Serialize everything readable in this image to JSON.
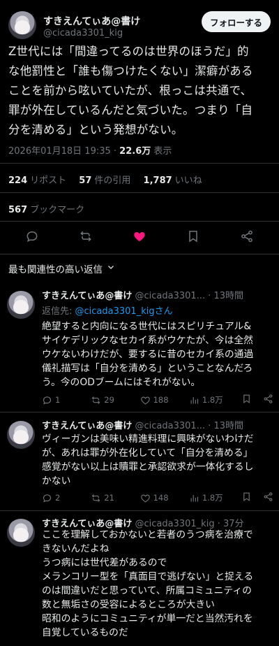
{
  "main": {
    "author_name": "すきえんてぃあ@書け",
    "handle": "@cicada3301_kig",
    "follow_label": "フォローする",
    "text": "Z世代には「間違ってるのは世界のほうだ」的\nな他罰性と「誰も傷つけたくない」潔癖がある\nことを前から呟いていたが、根っこは共通で、\n罪が外在しているんだと気づいた。つまり「自\n分を清める」という発想がない。",
    "date": "2026年01月18日 19:35 · ",
    "views": "22.6万",
    "views_label": " 表示"
  },
  "stats": {
    "reposts": "224",
    "reposts_label": "リポスト",
    "quotes": "57",
    "quotes_label": "件の引用",
    "likes": "1,787",
    "likes_label": "いいね",
    "bookmarks": "567",
    "bookmarks_label": "ブックマーク"
  },
  "sort_label": "最も関連性の高い返信",
  "replies": [
    {
      "name": "すきえんてぃあ@書け",
      "handle": "@cicada3301...",
      "time": "· 13時間",
      "reply_to_prefix": "返信先: ",
      "reply_to": "@cicada3301_kigさん",
      "text": "絶望すると内向になる世代にはスピリチュアル&\nサイケデリックなセカイ系がウケたが、今は全然\nウケないわけだが、要するに昔のセカイ系の通過\n儀礼描写は「自分を清める」ということなんだろ\nう。今のODブームにはそれがない。",
      "replies": "1",
      "reposts": "29",
      "likes": "188",
      "views": "1.8万"
    },
    {
      "name": "すきえんてぃあ@書け",
      "handle": "@cicada3301...",
      "time": "· 13時間",
      "text": "ヴィーガンは美味い精進料理に興味がないわけだ\nが、あれは罪が外在化していて「自分を清める」\n感覚がない以上は贖罪と承認欲求が一体化するし\nかない",
      "replies": "2",
      "reposts": "21",
      "likes": "148",
      "views": "1.8万"
    },
    {
      "name": "すきえんてぃあ@書け",
      "handle": "@cicada3301_kig",
      "time": "· 37分",
      "text": "ここを理解しておかないと若者のうつ病を治療で\nきないんだよね\nうつ病には世代差があるので\nメランコリー型を「真面目で逃げない」と捉える\nのは間違いだと思っていて、所属コミュニティの\n数と無垢さの受容によるところが大きい\n昭和のようにコミュニティが単一だと当然汚れを\n自覚しているものだ"
    }
  ],
  "colors": {
    "accent": "#1d9bf0",
    "like": "#f91880",
    "muted": "#71767b",
    "text": "#e7e9ea",
    "background": "#000000"
  }
}
